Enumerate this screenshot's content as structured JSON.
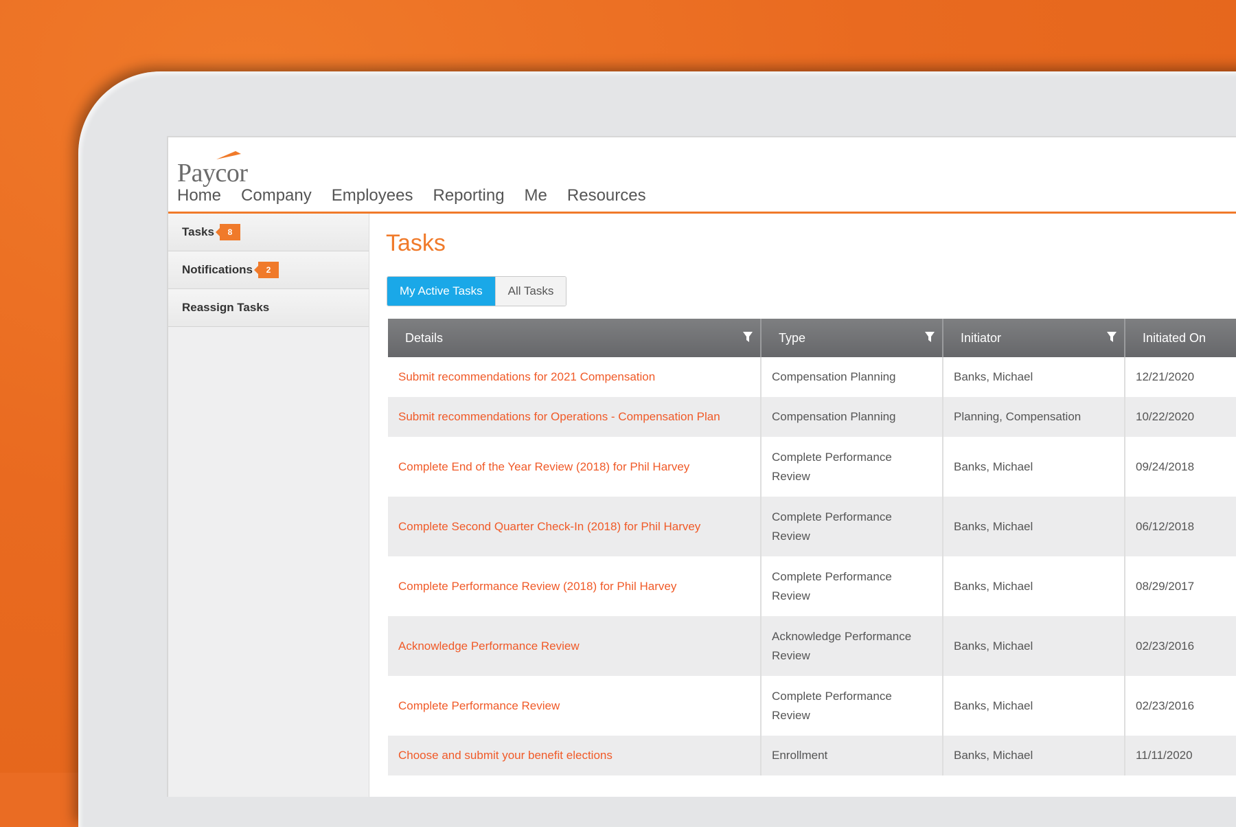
{
  "app": {
    "logo_text": "Paycor",
    "brand_color": "#f07a2a",
    "accent_blue": "#1aa8e8"
  },
  "nav": {
    "items": [
      "Home",
      "Company",
      "Employees",
      "Reporting",
      "Me",
      "Resources"
    ]
  },
  "sidebar": {
    "items": [
      {
        "label": "Tasks",
        "badge": "8"
      },
      {
        "label": "Notifications",
        "badge": "2"
      },
      {
        "label": "Reassign Tasks",
        "badge": ""
      }
    ]
  },
  "main": {
    "title": "Tasks",
    "tabs": [
      {
        "label": "My Active Tasks",
        "active": true
      },
      {
        "label": "All Tasks",
        "active": false
      }
    ],
    "table": {
      "columns": [
        "Details",
        "Type",
        "Initiator",
        "Initiated On"
      ],
      "rows": [
        {
          "details": "Submit recommendations for 2021 Compensation",
          "type": "Compensation Planning",
          "initiator": "Banks, Michael",
          "date": "12/21/2020"
        },
        {
          "details": "Submit recommendations for Operations - Compensation Plan",
          "type": "Compensation Planning",
          "initiator": "Planning, Compensation",
          "date": "10/22/2020"
        },
        {
          "details": "Complete End of the Year Review (2018) for Phil Harvey",
          "type": "Complete Performance Review",
          "initiator": "Banks, Michael",
          "date": "09/24/2018"
        },
        {
          "details": "Complete Second Quarter Check-In (2018) for Phil Harvey",
          "type": "Complete Performance Review",
          "initiator": "Banks, Michael",
          "date": "06/12/2018"
        },
        {
          "details": "Complete Performance Review (2018) for Phil Harvey",
          "type": "Complete Performance Review",
          "initiator": "Banks, Michael",
          "date": "08/29/2017"
        },
        {
          "details": "Acknowledge Performance Review",
          "type": "Acknowledge Performance Review",
          "initiator": "Banks, Michael",
          "date": "02/23/2016"
        },
        {
          "details": "Complete Performance Review",
          "type": "Complete Performance Review",
          "initiator": "Banks, Michael",
          "date": "02/23/2016"
        },
        {
          "details": "Choose and submit your benefit elections",
          "type": "Enrollment",
          "initiator": "Banks, Michael",
          "date": "11/11/2020"
        }
      ]
    }
  }
}
